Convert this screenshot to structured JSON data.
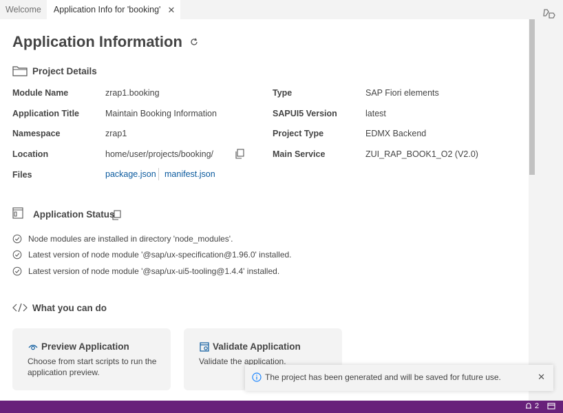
{
  "tabs": [
    {
      "label": "Welcome"
    },
    {
      "label": "Application Info for 'booking'"
    }
  ],
  "page": {
    "title": "Application Information"
  },
  "project_details": {
    "title": "Project Details",
    "module_name_label": "Module Name",
    "module_name_value": "zrap1.booking",
    "app_title_label": "Application Title",
    "app_title_value": "Maintain Booking Information",
    "namespace_label": "Namespace",
    "namespace_value": "zrap1",
    "location_label": "Location",
    "location_value": "home/user/projects/booking/",
    "files_label": "Files",
    "file1": "package.json",
    "file2": "manifest.json",
    "type_label": "Type",
    "type_value": "SAP Fiori elements",
    "sapui5_label": "SAPUI5 Version",
    "sapui5_value": "latest",
    "project_type_label": "Project Type",
    "project_type_value": "EDMX Backend",
    "main_service_label": "Main Service",
    "main_service_value": "ZUI_RAP_BOOK1_O2 (V2.0)"
  },
  "app_status": {
    "title": "Application Status",
    "items": [
      "Node modules are installed in directory 'node_modules'.",
      "Latest version of node module '@sap/ux-specification@1.96.0' installed.",
      "Latest version of node module '@sap/ux-ui5-tooling@1.4.4' installed."
    ]
  },
  "what_you_can_do": {
    "title": "What you can do",
    "cards": [
      {
        "title": "Preview Application",
        "desc": "Choose from start scripts to run the application preview."
      },
      {
        "title": "Validate Application",
        "desc": "Validate the application."
      }
    ]
  },
  "notification": {
    "text": "The project has been generated and will be saved for future use."
  },
  "statusbar": {
    "notifications_count": "2"
  },
  "colors": {
    "accent_link": "#0a5a9e",
    "statusbar_bg": "#68217a",
    "info_icon": "#1a85ff"
  }
}
